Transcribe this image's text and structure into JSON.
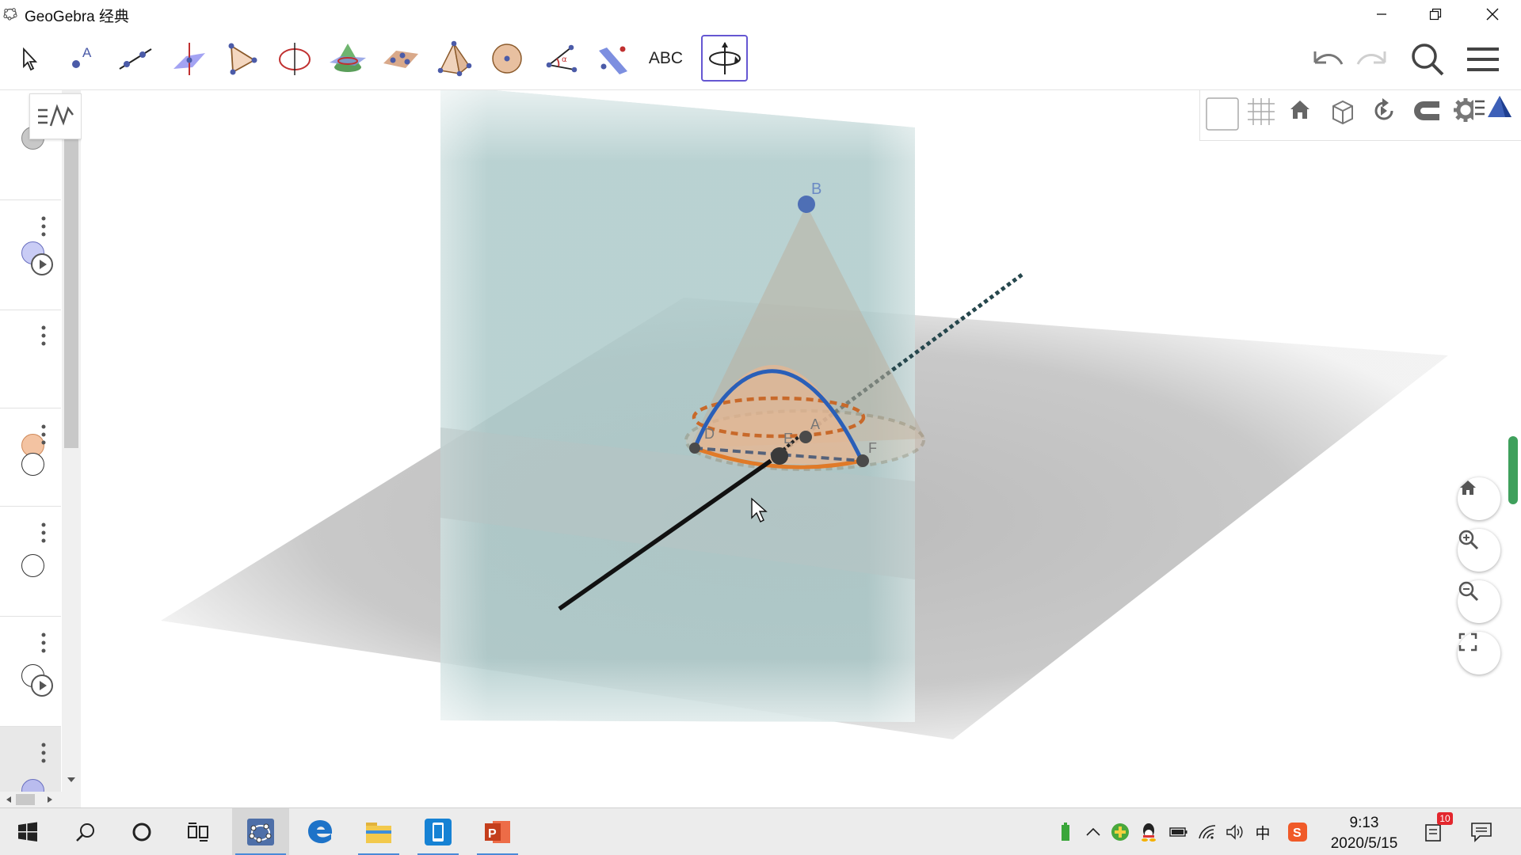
{
  "window": {
    "title": "GeoGebra 经典",
    "buttons": [
      "minimize",
      "restore",
      "close"
    ]
  },
  "toolbar": {
    "tools": [
      {
        "name": "move-tool",
        "icon": "arrow-cursor-icon"
      },
      {
        "name": "point-tool",
        "icon": "point-icon"
      },
      {
        "name": "line-tool",
        "icon": "line-icon"
      },
      {
        "name": "perpendicular-line-tool",
        "icon": "perpendicular-icon"
      },
      {
        "name": "polygon-tool",
        "icon": "polygon-icon"
      },
      {
        "name": "circle-axis-tool",
        "icon": "circle-axis-icon"
      },
      {
        "name": "intersect-surfaces-tool",
        "icon": "cone-plane-icon"
      },
      {
        "name": "plane-tool",
        "icon": "plane-points-icon"
      },
      {
        "name": "pyramid-tool",
        "icon": "pyramid-icon"
      },
      {
        "name": "sphere-tool",
        "icon": "sphere-icon"
      },
      {
        "name": "angle-tool",
        "icon": "angle-icon"
      },
      {
        "name": "reflect-tool",
        "icon": "reflect-icon"
      },
      {
        "name": "text-tool",
        "icon": "text-icon",
        "label": "ABC"
      },
      {
        "name": "rotate-view-tool",
        "icon": "rotate-view-icon",
        "active": true
      }
    ],
    "right": [
      "undo-icon",
      "redo-icon",
      "search-icon",
      "menu-icon"
    ]
  },
  "algebra": {
    "rows": [
      {
        "marble": "#c8c8c8",
        "play": false
      },
      {
        "marble": "#c9ccf5",
        "play": true
      },
      {
        "marble": "#f3c3a2",
        "play": false
      },
      {
        "marble": "#ffffff",
        "play": false
      },
      {
        "marble": "#ffffff",
        "play": false
      },
      {
        "marble": "#ffffff",
        "play": true
      },
      {
        "marble": "#b9bcee",
        "play": true
      }
    ]
  },
  "view3d": {
    "points": [
      {
        "label": "B",
        "color": "#4e6fb5"
      },
      {
        "label": "A",
        "color": "#555555"
      },
      {
        "label": "E",
        "color": "#555555"
      },
      {
        "label": "F",
        "color": "#555555"
      },
      {
        "label": "D",
        "color": "#555555"
      }
    ],
    "stylebar": [
      "background-toggle",
      "grid-icon",
      "home-icon",
      "cube-view-icon",
      "rotate-icon",
      "magnet-icon",
      "gear-icon",
      "more-icon",
      "graphics-style-icon"
    ],
    "zoom_buttons": [
      "home-icon",
      "zoom-in-icon",
      "zoom-out-icon",
      "fullscreen-icon"
    ]
  },
  "taskbar": {
    "apps": [
      "start-icon",
      "search-icon",
      "cortana-icon",
      "task-view-icon",
      "geogebra-icon",
      "edge-icon",
      "file-explorer-icon",
      "phone-app-icon",
      "powerpoint-icon"
    ],
    "tray": [
      "battery-saver-icon",
      "chevron-up-icon",
      "game-icon",
      "qq-icon",
      "battery-icon",
      "wifi-icon",
      "volume-icon",
      "ime-icon",
      "sogou-icon"
    ],
    "ime": "中",
    "time": "9:13",
    "date": "2020/5/15",
    "notifications": "10"
  }
}
